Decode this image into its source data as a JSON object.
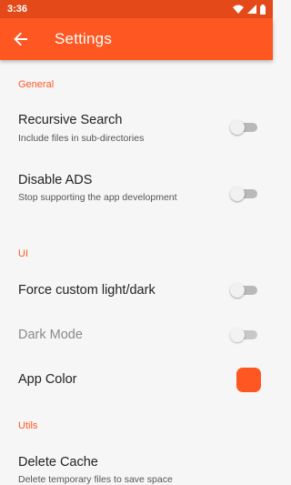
{
  "status_bar": {
    "time": "3:36",
    "icons": [
      "wifi-icon",
      "signal-icon",
      "battery-icon"
    ]
  },
  "app_bar": {
    "title": "Settings",
    "back_icon": "arrow-back-icon"
  },
  "colors": {
    "accent": "#fe5722",
    "status_bar": "#e44a19",
    "background": "#f6f6f6",
    "app_color_value": "#fe5722"
  },
  "sections": {
    "general": {
      "header": "General",
      "recursive_search": {
        "title": "Recursive Search",
        "summary": "Include files in sub-directories",
        "enabled": false
      },
      "disable_ads": {
        "title": "Disable ADS",
        "summary": "Stop supporting the app development",
        "enabled": false
      }
    },
    "ui": {
      "header": "UI",
      "force_custom_theme": {
        "title": "Force custom light/dark",
        "enabled": false
      },
      "dark_mode": {
        "title": "Dark Mode",
        "enabled": false,
        "disabled": true
      },
      "app_color": {
        "title": "App Color"
      }
    },
    "utils": {
      "header": "Utils",
      "delete_cache": {
        "title": "Delete Cache",
        "summary": "Delete temporary files to save space"
      }
    }
  }
}
